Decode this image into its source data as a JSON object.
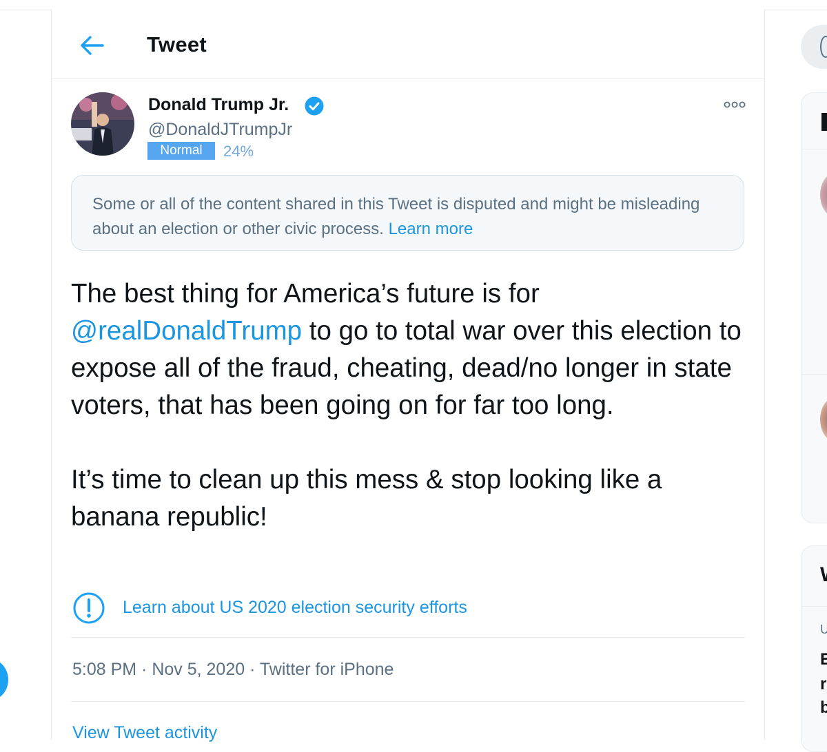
{
  "header": {
    "title": "Tweet"
  },
  "author": {
    "name": "Donald Trump Jr.",
    "handle": "@DonaldJTrumpJr",
    "badge": "Normal",
    "percent": "24%"
  },
  "notice": {
    "text": "Some or all of the content shared in this Tweet is disputed and might be misleading about an election or other civic process.",
    "link": "Learn more"
  },
  "tweet": {
    "mention": "@realDonaldTrump",
    "p1_before": "The best thing for America’s future is for",
    "p1_after": "to go to total war over this election to expose all of the fraud, cheating, dead/no longer in state voters, that has been going on for far too long.",
    "p2": "It’s time to clean up this mess & stop looking like a banana republic!"
  },
  "info_link": "Learn about US 2020 election security efforts",
  "meta": "5:08 PM · Nov 5, 2020 · Twitter for iPhone",
  "sidebar": {
    "card2_letter": "W",
    "line_u": "U",
    "line1": "E",
    "line2": "r",
    "line3": "b"
  },
  "colors": {
    "accent": "#1da1f2",
    "text": "#0f1419",
    "secondary": "#5b7083",
    "badge": "#55a6ee"
  }
}
